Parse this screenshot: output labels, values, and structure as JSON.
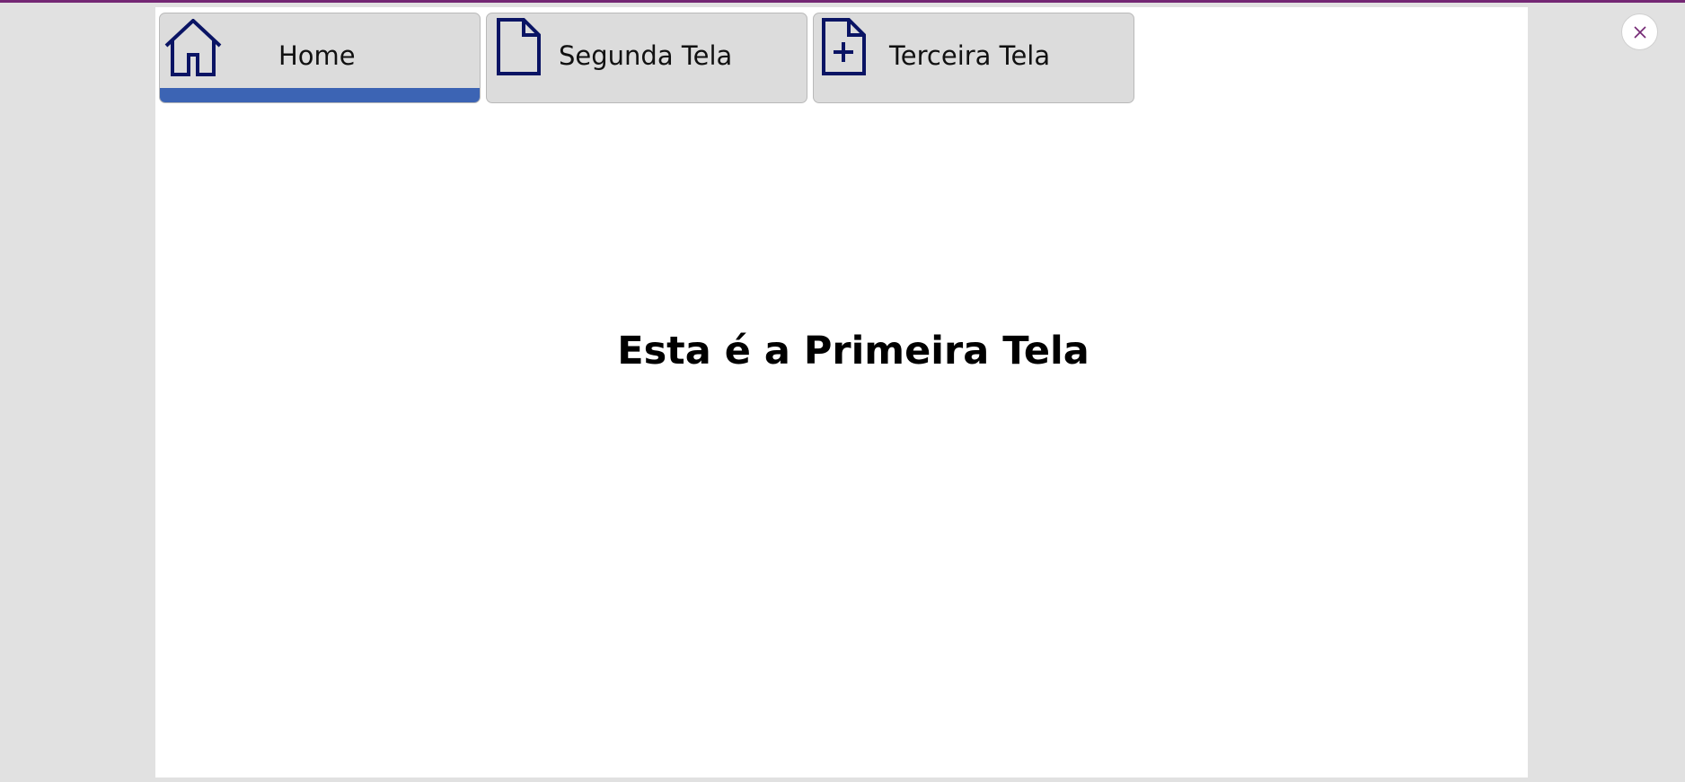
{
  "app": {
    "accent_color": "#742774"
  },
  "nav": {
    "active_indicator_color": "#3c64b4",
    "icon_color": "#0a1464",
    "tabs": [
      {
        "label": "Home",
        "icon": "home-icon",
        "active": true
      },
      {
        "label": "Segunda Tela",
        "icon": "document-icon",
        "active": false
      },
      {
        "label": "Terceira Tela",
        "icon": "document-add-icon",
        "active": false
      }
    ]
  },
  "main": {
    "heading": "Esta é a Primeira Tela"
  },
  "window": {
    "close_icon": "close-icon"
  }
}
